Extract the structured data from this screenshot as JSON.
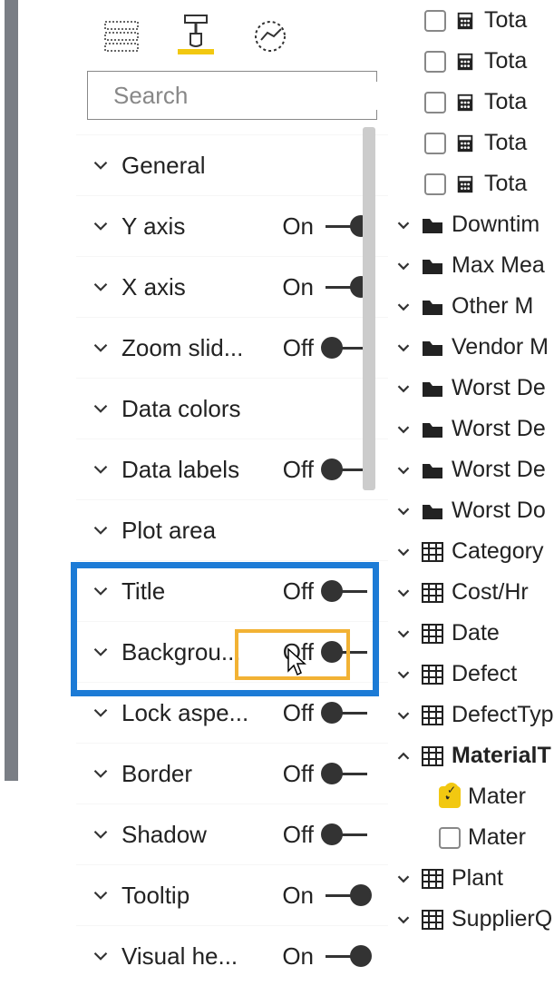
{
  "search": {
    "placeholder": "Search"
  },
  "format_options": [
    {
      "label": "General",
      "toggle": null
    },
    {
      "label": "Y axis",
      "toggle": "On"
    },
    {
      "label": "X axis",
      "toggle": "On"
    },
    {
      "label": "Zoom slid...",
      "toggle": "Off"
    },
    {
      "label": "Data colors",
      "toggle": null
    },
    {
      "label": "Data labels",
      "toggle": "Off"
    },
    {
      "label": "Plot area",
      "toggle": null
    },
    {
      "label": "Title",
      "toggle": "Off"
    },
    {
      "label": "Backgrou...",
      "toggle": "Off"
    },
    {
      "label": "Lock aspe...",
      "toggle": "Off"
    },
    {
      "label": "Border",
      "toggle": "Off"
    },
    {
      "label": "Shadow",
      "toggle": "Off"
    },
    {
      "label": "Tooltip",
      "toggle": "On"
    },
    {
      "label": "Visual he...",
      "toggle": "On"
    }
  ],
  "fields": {
    "top_measures": [
      "Tota",
      "Tota",
      "Tota",
      "Tota",
      "Tota"
    ],
    "folders": [
      "Downtim",
      "Max Mea",
      "Other M",
      "Vendor M",
      "Worst De",
      "Worst De",
      "Worst De",
      "Worst Do"
    ],
    "tables": [
      "Category",
      "Cost/Hr",
      "Date",
      "Defect",
      "DefectTyp"
    ],
    "selected_table": "MaterialT",
    "selected_children": [
      {
        "label": "Mater",
        "checked": true
      },
      {
        "label": "Mater",
        "checked": false
      }
    ],
    "bottom_tables": [
      "Plant",
      "SupplierQ"
    ]
  }
}
